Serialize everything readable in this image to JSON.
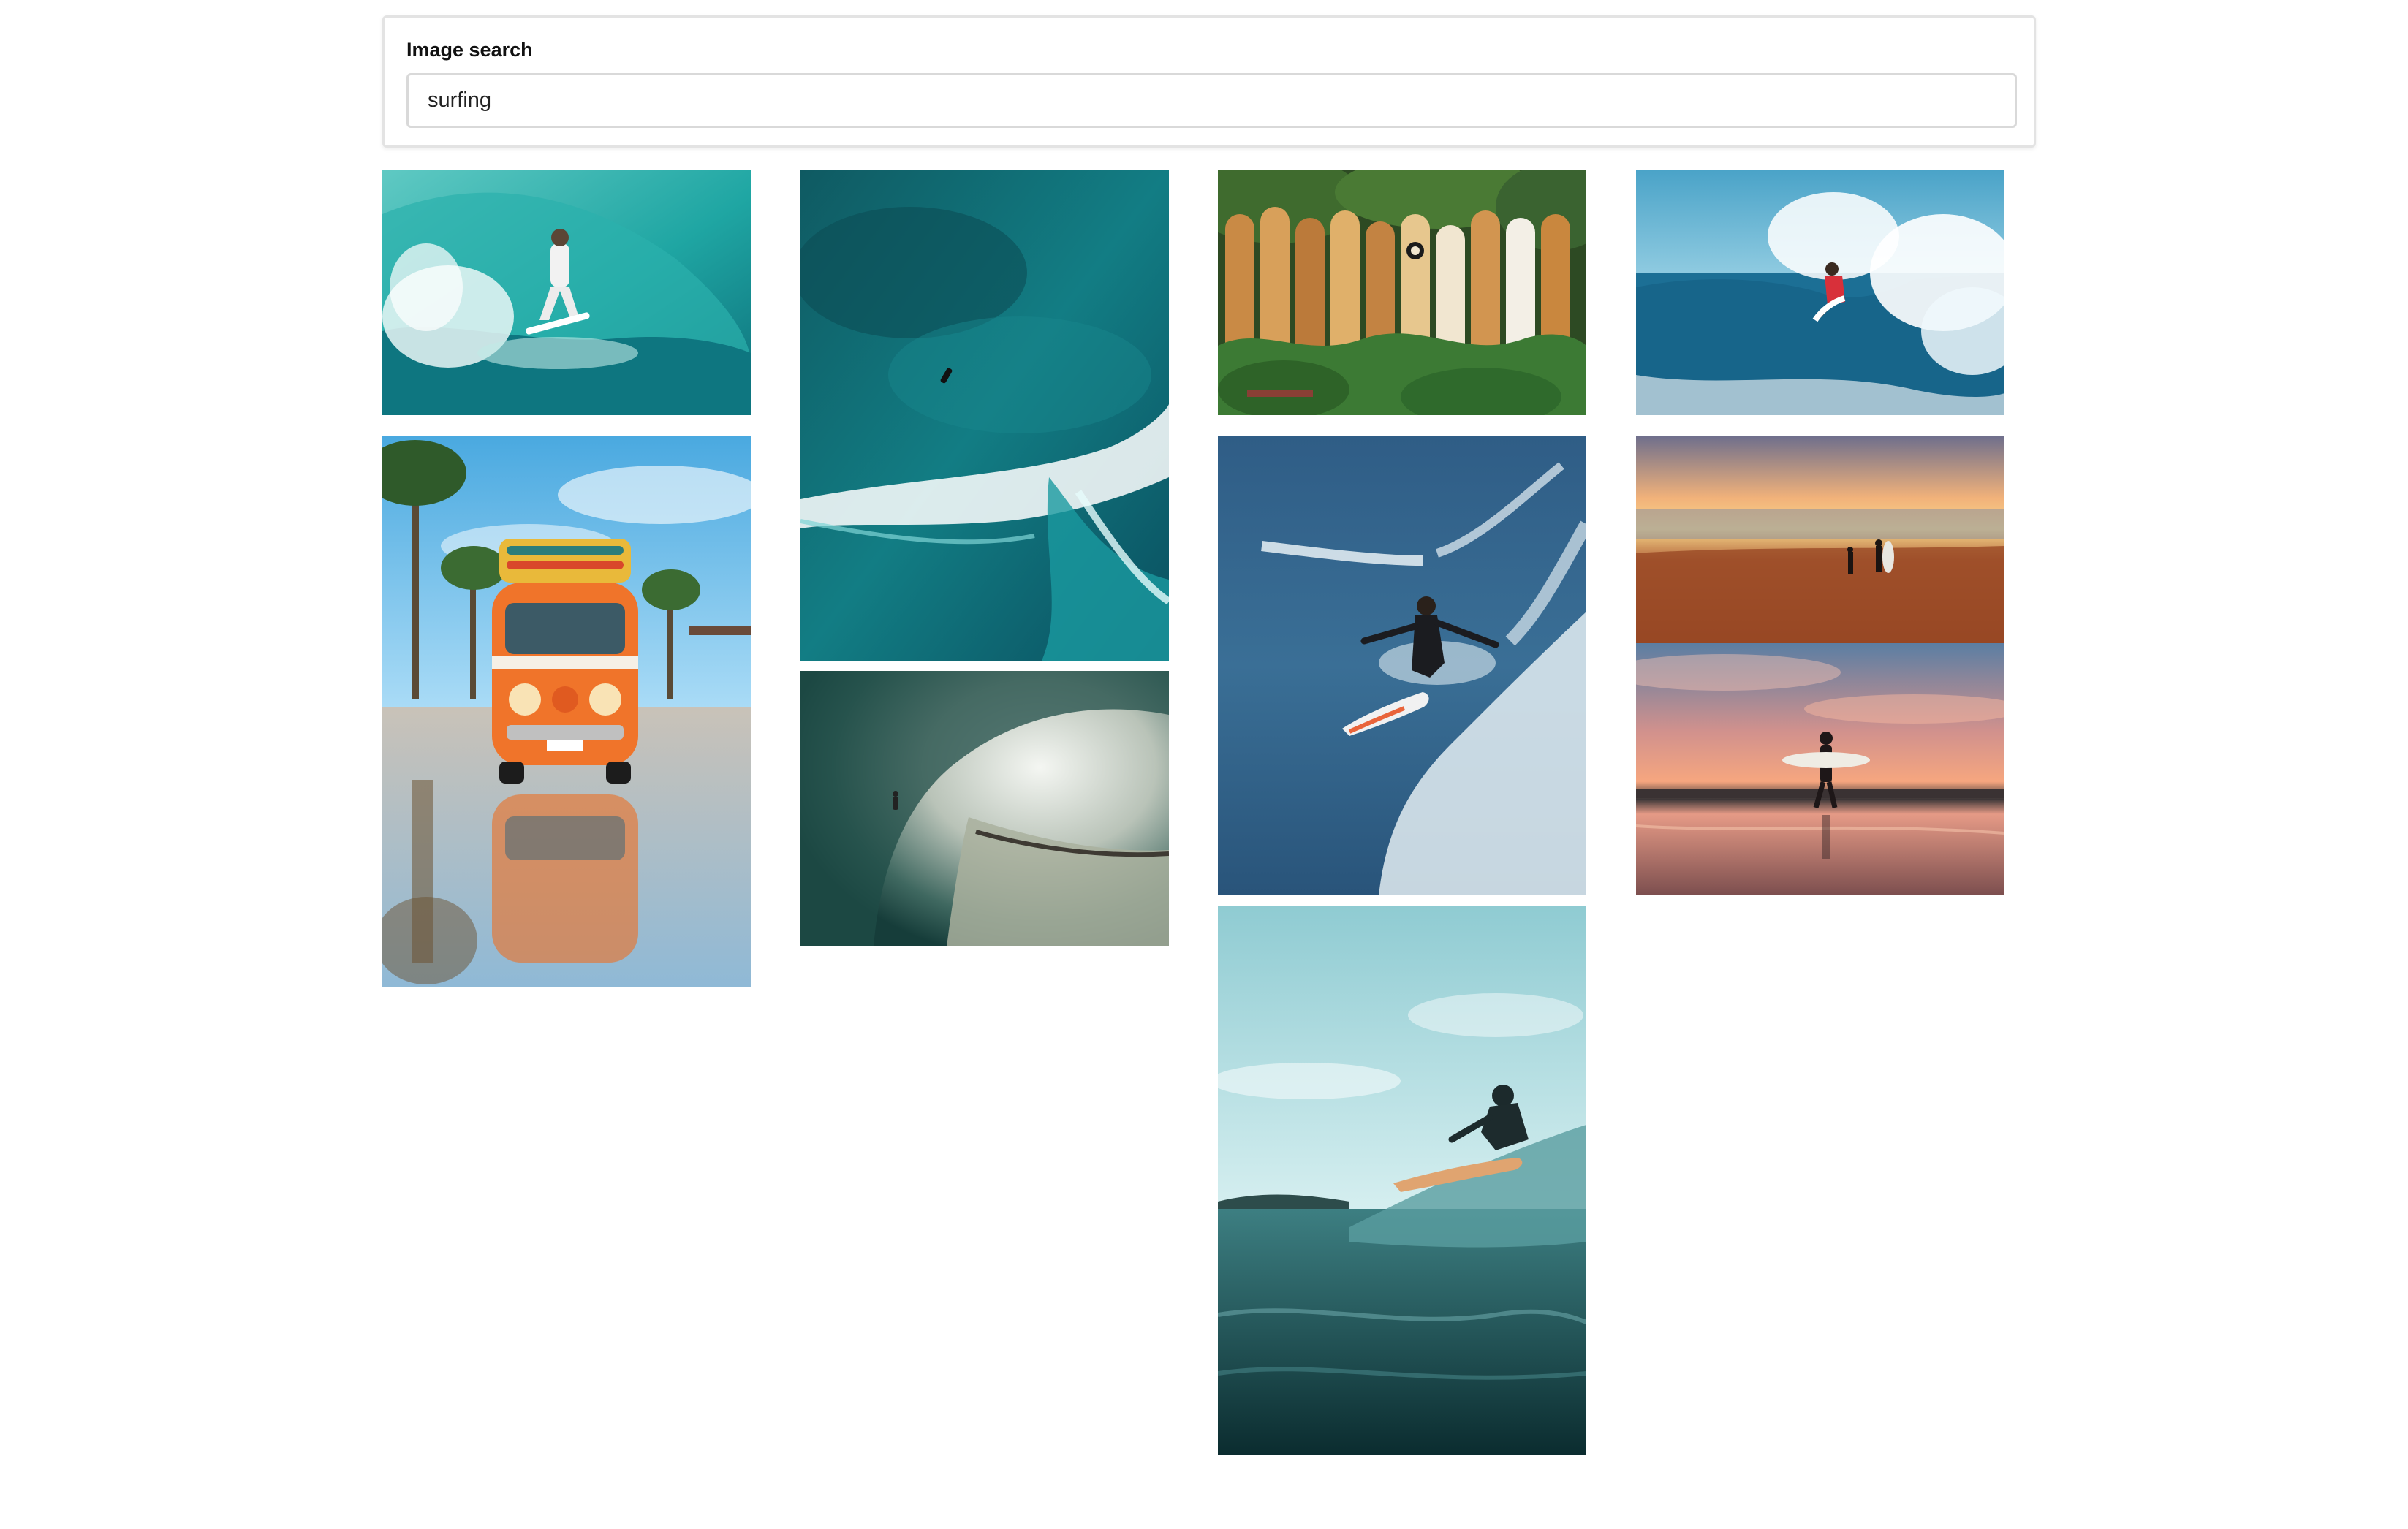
{
  "search": {
    "label": "Image search",
    "value": "surfing"
  },
  "results": {
    "photo_names": [
      "surfer-in-barrel-wave",
      "orange-van-with-surfboards",
      "aerial-ocean-wave",
      "inside-wave-tube",
      "surfboards-against-foliage",
      "surfer-on-blue-wave",
      "surfer-riding-white-surfboard",
      "surfer-on-teal-water",
      "two-surfers-on-beach-sunset",
      "surfer-silhouette-pink-sunset"
    ]
  }
}
